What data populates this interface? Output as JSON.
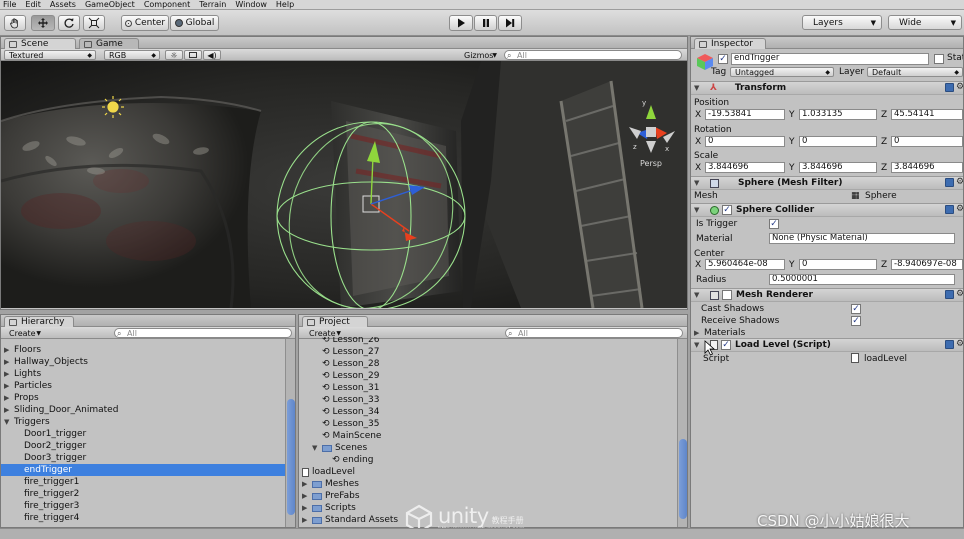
{
  "menu": [
    "File",
    "Edit",
    "Assets",
    "GameObject",
    "Component",
    "Terrain",
    "Window",
    "Help"
  ],
  "toolbar": {
    "pivot_label": "Center",
    "space_label": "Global",
    "layers_label": "Layers",
    "layout_label": "Wide"
  },
  "scene": {
    "tab": "Scene",
    "game_tab": "Game",
    "render_mode": "Textured",
    "color_mode": "RGB",
    "gizmos": "Gizmos",
    "search_placeholder": "All",
    "persp_label": "Persp"
  },
  "hierarchy": {
    "tab": "Hierarchy",
    "create_label": "Create",
    "search_placeholder": "All",
    "items": [
      {
        "label": "Floors",
        "indent": 0,
        "expand": "closed"
      },
      {
        "label": "Hallway_Objects",
        "indent": 0,
        "expand": "closed"
      },
      {
        "label": "Lights",
        "indent": 0,
        "expand": "closed"
      },
      {
        "label": "Particles",
        "indent": 0,
        "expand": "closed"
      },
      {
        "label": "Props",
        "indent": 0,
        "expand": "closed"
      },
      {
        "label": "Sliding_Door_Animated",
        "indent": 0,
        "expand": "closed"
      },
      {
        "label": "Triggers",
        "indent": 0,
        "expand": "open"
      },
      {
        "label": "Door1_trigger",
        "indent": 1,
        "expand": "none"
      },
      {
        "label": "Door2_trigger",
        "indent": 1,
        "expand": "none"
      },
      {
        "label": "Door3_trigger",
        "indent": 1,
        "expand": "none"
      },
      {
        "label": "endTrigger",
        "indent": 1,
        "expand": "none",
        "selected": true
      },
      {
        "label": "fire_trigger1",
        "indent": 1,
        "expand": "none"
      },
      {
        "label": "fire_trigger2",
        "indent": 1,
        "expand": "none"
      },
      {
        "label": "fire_trigger3",
        "indent": 1,
        "expand": "none"
      },
      {
        "label": "fire_trigger4",
        "indent": 1,
        "expand": "none"
      }
    ]
  },
  "project": {
    "tab": "Project",
    "create_label": "Create",
    "search_placeholder": "All",
    "items": [
      {
        "label": "Lesson_26",
        "indent": 2,
        "kind": "scene"
      },
      {
        "label": "Lesson_27",
        "indent": 2,
        "kind": "scene"
      },
      {
        "label": "Lesson_28",
        "indent": 2,
        "kind": "scene"
      },
      {
        "label": "Lesson_29",
        "indent": 2,
        "kind": "scene"
      },
      {
        "label": "Lesson_31",
        "indent": 2,
        "kind": "scene"
      },
      {
        "label": "Lesson_33",
        "indent": 2,
        "kind": "scene"
      },
      {
        "label": "Lesson_34",
        "indent": 2,
        "kind": "scene"
      },
      {
        "label": "Lesson_35",
        "indent": 2,
        "kind": "scene"
      },
      {
        "label": "MainScene",
        "indent": 2,
        "kind": "scene"
      },
      {
        "label": "Scenes",
        "indent": 1,
        "kind": "folder-open"
      },
      {
        "label": "ending",
        "indent": 3,
        "kind": "scene"
      },
      {
        "label": "loadLevel",
        "indent": 0,
        "kind": "script"
      },
      {
        "label": "Meshes",
        "indent": 0,
        "kind": "folder"
      },
      {
        "label": "PreFabs",
        "indent": 0,
        "kind": "folder"
      },
      {
        "label": "Scripts",
        "indent": 0,
        "kind": "folder"
      },
      {
        "label": "Standard Assets",
        "indent": 0,
        "kind": "folder"
      }
    ]
  },
  "inspector": {
    "tab": "Inspector",
    "object_name": "endTrigger",
    "static_label": "Stat",
    "tag_label": "Tag",
    "tag_value": "Untagged",
    "layer_label": "Layer",
    "layer_value": "Default",
    "transform": {
      "title": "Transform",
      "position_label": "Position",
      "rotation_label": "Rotation",
      "scale_label": "Scale",
      "position": {
        "x": "-19.53841",
        "y": "1.033135",
        "z": "45.54141"
      },
      "rotation": {
        "x": "0",
        "y": "0",
        "z": "0"
      },
      "scale": {
        "x": "3.844696",
        "y": "3.844696",
        "z": "3.844696"
      }
    },
    "axis": {
      "x": "X",
      "y": "Y",
      "z": "Z"
    },
    "mesh_filter": {
      "title": "Sphere (Mesh Filter)",
      "mesh_label": "Mesh",
      "mesh_value": "Sphere"
    },
    "sphere_collider": {
      "title": "Sphere Collider",
      "is_trigger_label": "Is Trigger",
      "material_label": "Material",
      "material_value": "None (Physic Material)",
      "center_label": "Center",
      "center": {
        "x": "5.960464e-08",
        "y": "0",
        "z": "-8.940697e-08"
      },
      "radius_label": "Radius",
      "radius_value": "0.5000001"
    },
    "mesh_renderer": {
      "title": "Mesh Renderer",
      "cast_shadows_label": "Cast Shadows",
      "receive_shadows_label": "Receive Shadows",
      "materials_label": "Materials"
    },
    "load_level": {
      "title": "Load Level (Script)",
      "script_label": "Script",
      "script_value": "loadLevel"
    }
  },
  "watermark": {
    "brand": "unity",
    "brand_cn": "教程手册",
    "url": "http://www.unitymanual.com",
    "csdn": "CSDN @小小姑娘很大"
  },
  "colors": {
    "selection": "#3d80df",
    "gizmo_green": "#9ae08c",
    "axis_y": "#8fd63c",
    "axis_x": "#e8401e",
    "axis_z": "#2d5fd8"
  }
}
